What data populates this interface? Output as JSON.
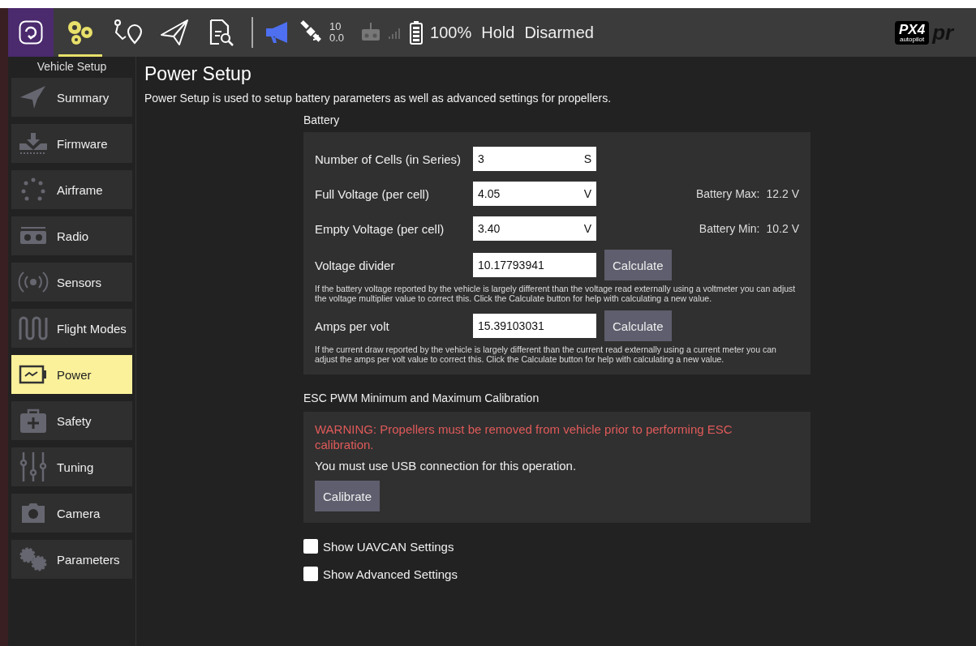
{
  "toolbar": {
    "tools": [
      {
        "selected": false
      },
      {
        "selected": true
      },
      {
        "selected": false
      },
      {
        "selected": false
      },
      {
        "selected": false
      }
    ],
    "satellite_count": "10",
    "hdop": "0.0",
    "battery": "100%",
    "flight_mode": "Hold",
    "arm_state": "Disarmed",
    "logo": {
      "mark": "PX4",
      "sub": "autopilot",
      "word": "pr"
    }
  },
  "sidebar": {
    "title": "Vehicle Setup",
    "items": [
      {
        "label": "Summary",
        "selected": false
      },
      {
        "label": "Firmware",
        "selected": false
      },
      {
        "label": "Airframe",
        "selected": false
      },
      {
        "label": "Radio",
        "selected": false
      },
      {
        "label": "Sensors",
        "selected": false
      },
      {
        "label": "Flight Modes",
        "selected": false
      },
      {
        "label": "Power",
        "selected": true
      },
      {
        "label": "Safety",
        "selected": false
      },
      {
        "label": "Tuning",
        "selected": false
      },
      {
        "label": "Camera",
        "selected": false
      },
      {
        "label": "Parameters",
        "selected": false
      }
    ]
  },
  "page": {
    "title": "Power Setup",
    "description": "Power Setup is used to setup battery parameters as well as advanced settings for propellers.",
    "battery": {
      "heading": "Battery",
      "rows": [
        {
          "kind": "unit",
          "label": "Number of Cells (in Series)",
          "value": "3",
          "unit": "S"
        },
        {
          "kind": "unit",
          "label": "Full Voltage (per cell)",
          "value": "4.05",
          "unit": "V",
          "info_label": "Battery Max:",
          "info_value": "12.2 V"
        },
        {
          "kind": "unit",
          "label": "Empty Voltage (per cell)",
          "value": "3.40",
          "unit": "V",
          "info_label": "Battery Min:",
          "info_value": "10.2 V"
        },
        {
          "kind": "calc",
          "label": "Voltage divider",
          "value": "10.17793941",
          "button": "Calculate",
          "help": "If the battery voltage reported by the vehicle is largely different than the voltage read externally using a voltmeter you can adjust the voltage multiplier value to correct this. Click the Calculate button for help with calculating a new value."
        },
        {
          "kind": "calc",
          "label": "Amps per volt",
          "value": "15.39103031",
          "button": "Calculate",
          "help": "If the current draw reported by the vehicle is largely different than the current read externally using a current meter you can adjust the amps per volt value to correct this. Click the Calculate button for help with calculating a new value."
        }
      ]
    },
    "esc": {
      "heading": "ESC PWM Minimum and Maximum Calibration",
      "warning": "WARNING: Propellers must be removed from vehicle prior to performing ESC calibration.",
      "note": "You must use USB connection for this operation.",
      "button": "Calibrate"
    },
    "options": [
      {
        "label": "Show UAVCAN Settings",
        "checked": false
      },
      {
        "label": "Show Advanced Settings",
        "checked": false
      }
    ]
  }
}
